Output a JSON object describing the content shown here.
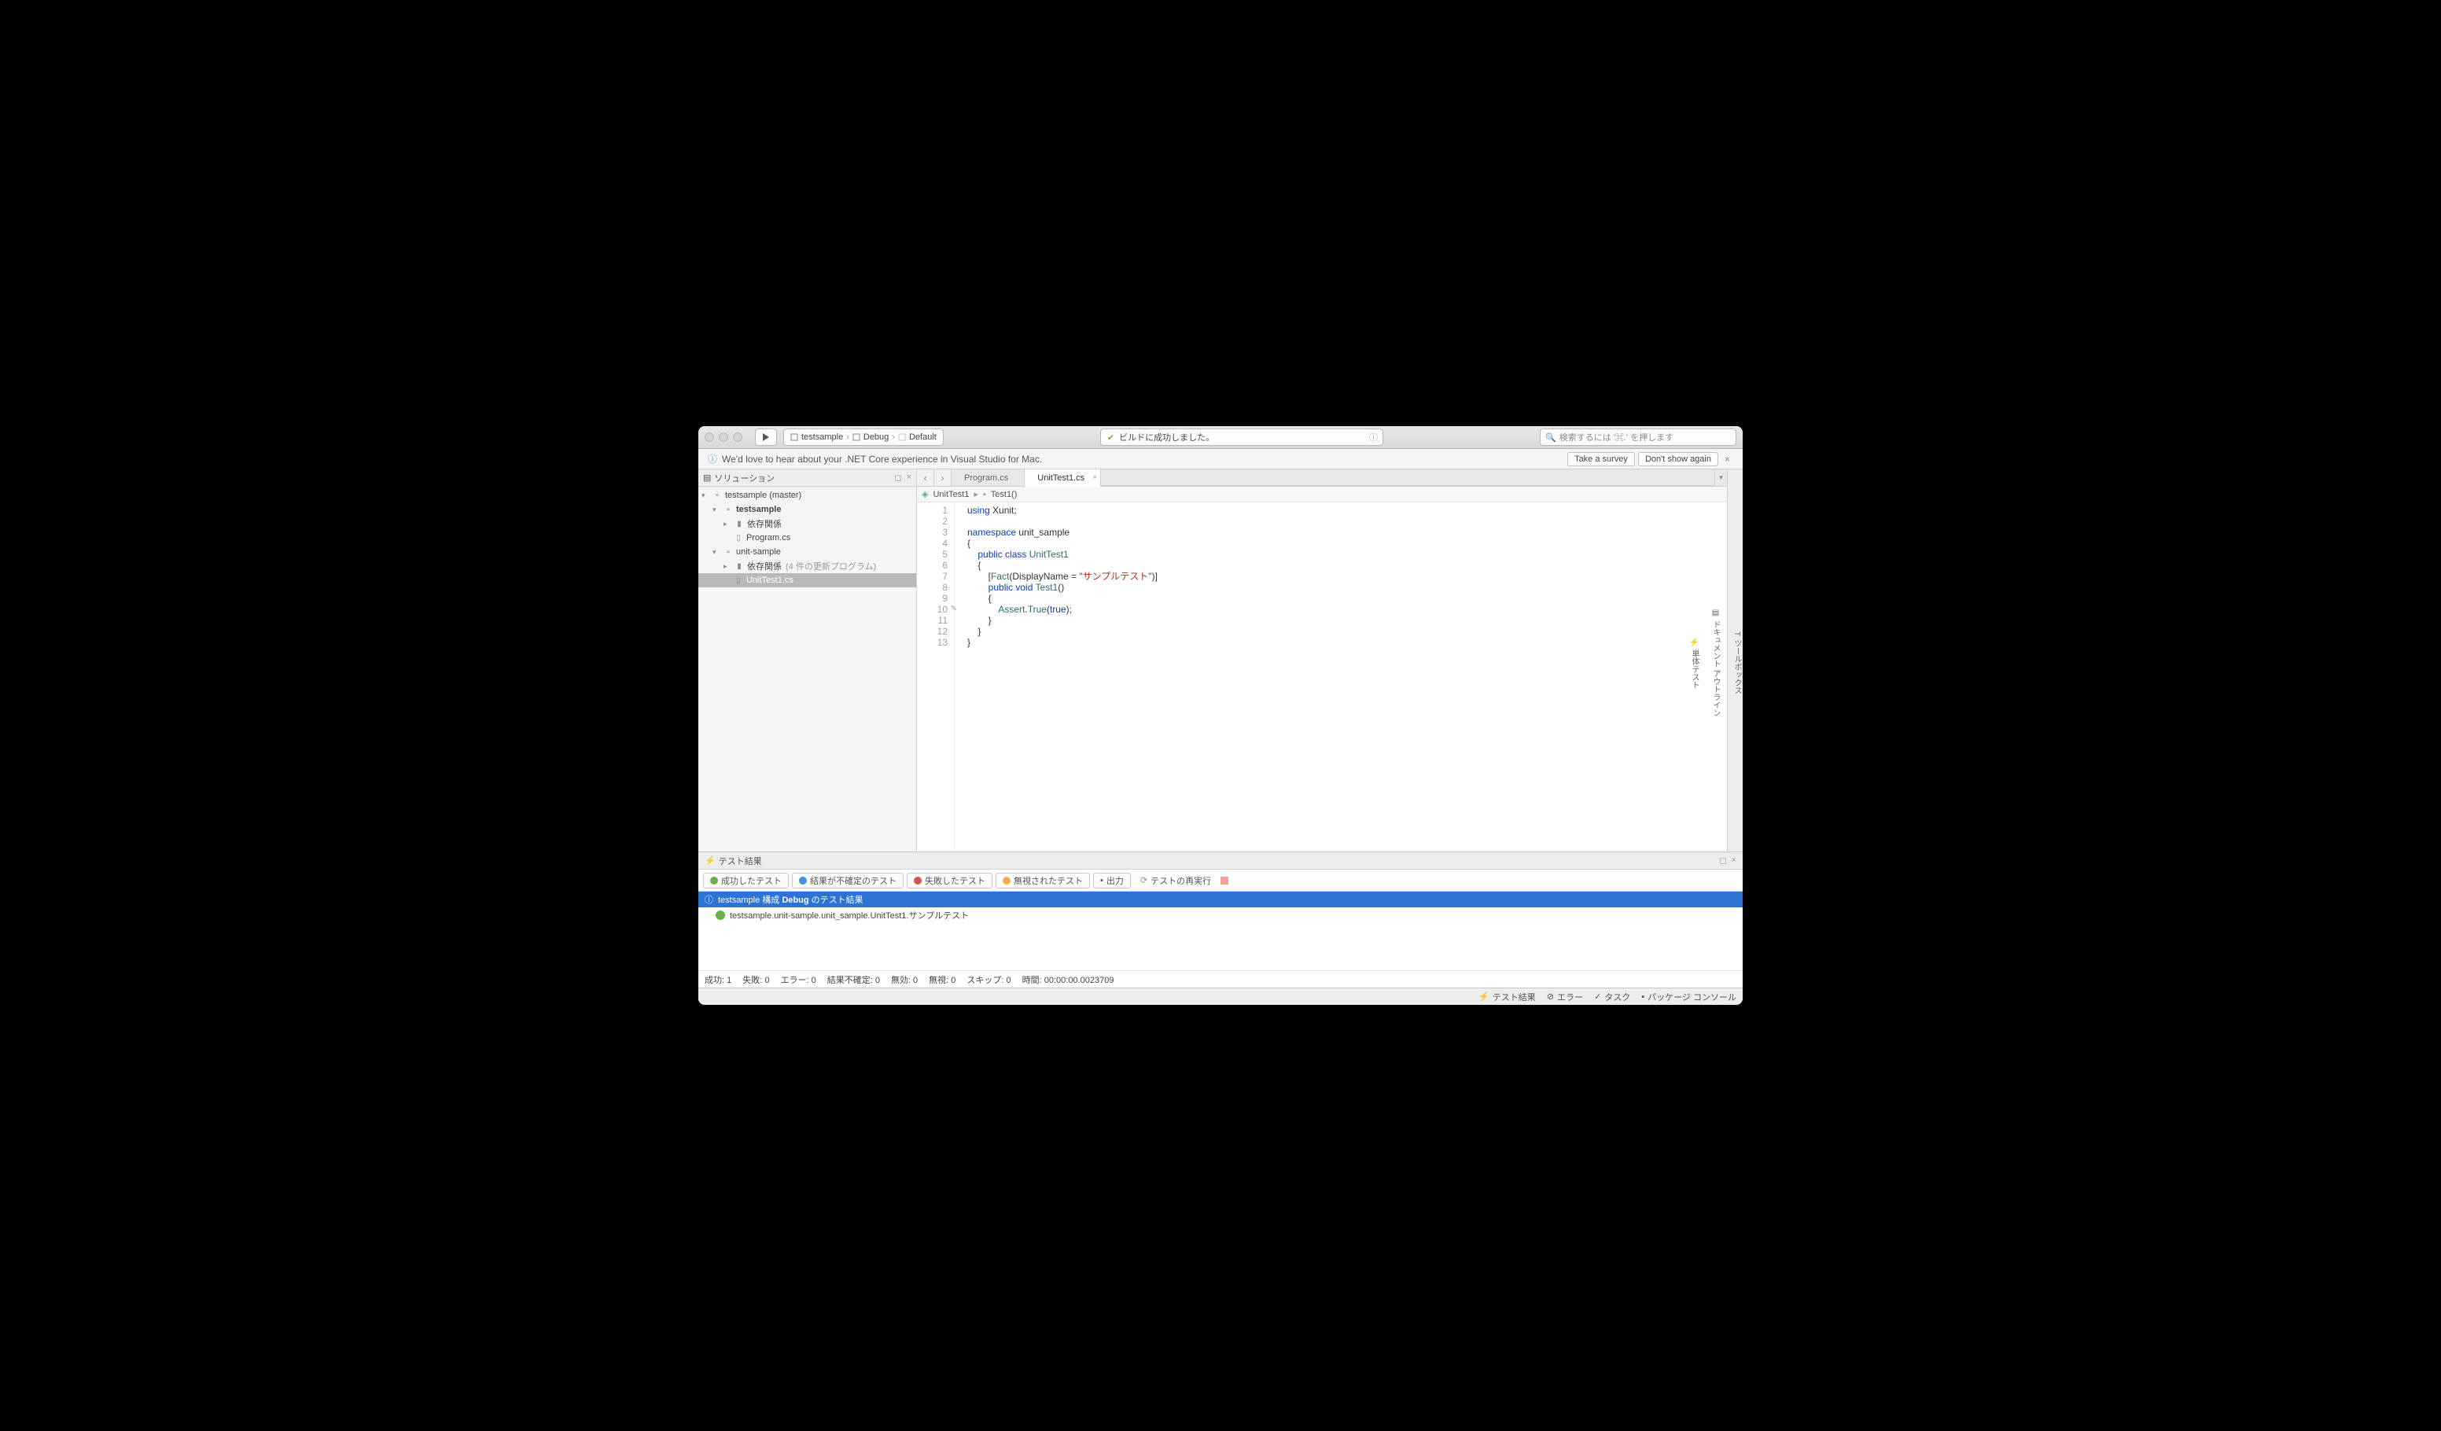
{
  "toolbar": {
    "breadcrumb": {
      "project": "testsample",
      "config": "Debug",
      "target": "Default"
    },
    "status_text": "ビルドに成功しました。",
    "search_placeholder": "検索するには '⌘.' を押します"
  },
  "banner": {
    "message": "We'd love to hear about your .NET Core experience in Visual Studio for Mac.",
    "survey_btn": "Take a survey",
    "dismiss_btn": "Don't show again"
  },
  "left": {
    "title": "ソリューション",
    "tree": {
      "root": "testsample (master)",
      "proj1": "testsample",
      "deps1": "依存関係",
      "file1": "Program.cs",
      "proj2": "unit-sample",
      "deps2": "依存関係",
      "deps2_suffix": "(4 件の更新プログラム)",
      "file2": "UnitTest1.cs"
    }
  },
  "tabs": {
    "tab1": "Program.cs",
    "tab2": "UnitTest1.cs"
  },
  "navbar": {
    "item1": "UnitTest1",
    "item2": "Test1()"
  },
  "code": {
    "lines": [
      1,
      2,
      3,
      4,
      5,
      6,
      7,
      8,
      9,
      10,
      11,
      12,
      13
    ],
    "l1": {
      "kw": "using",
      "txt": " Xunit;"
    },
    "l3": {
      "kw": "namespace",
      "txt": " unit_sample"
    },
    "l4_open": "{",
    "l5": {
      "kw1": "public",
      "kw2": "class",
      "cls": "UnitTest1"
    },
    "l6_open": "{",
    "l7": {
      "attr": "Fact",
      "prop": "DisplayName",
      "str": "\"サンプルテスト\""
    },
    "l8": {
      "kw1": "public",
      "kw2": "void",
      "mtd": "Test1"
    },
    "l9_open": "{",
    "l10": {
      "cls": "Assert",
      "mtd": "True",
      "arg": "true"
    },
    "l11_close": "}",
    "l12_close": "}",
    "l13_close": "}"
  },
  "bottom": {
    "title": "テスト結果",
    "filters": {
      "success": "成功したテスト",
      "inconclusive": "結果が不確定のテスト",
      "failed": "失敗したテスト",
      "ignored": "無視されたテスト",
      "output": "出力"
    },
    "rerun": "テストの再実行",
    "header_row": "testsample 構成 Debug のテスト結果",
    "header_bold": "Debug",
    "result_row": "testsample.unit-sample.unit_sample.UnitTest1.サンプルテスト",
    "summary": {
      "success": "成功: 1",
      "fail": "失敗: 0",
      "error": "エラー: 0",
      "inconclusive": "結果不確定: 0",
      "invalid": "無効: 0",
      "ignored": "無視: 0",
      "skip": "スキップ: 0",
      "time": "時間: 00:00:00.0023709"
    }
  },
  "rail": {
    "toolbox": "ツールボックス",
    "docoutline": "ドキュメント アウトライン",
    "unittest": "単体テスト"
  },
  "statusbar": {
    "tests": "テスト結果",
    "errors": "エラー",
    "tasks": "タスク",
    "console": "パッケージ コンソール"
  }
}
